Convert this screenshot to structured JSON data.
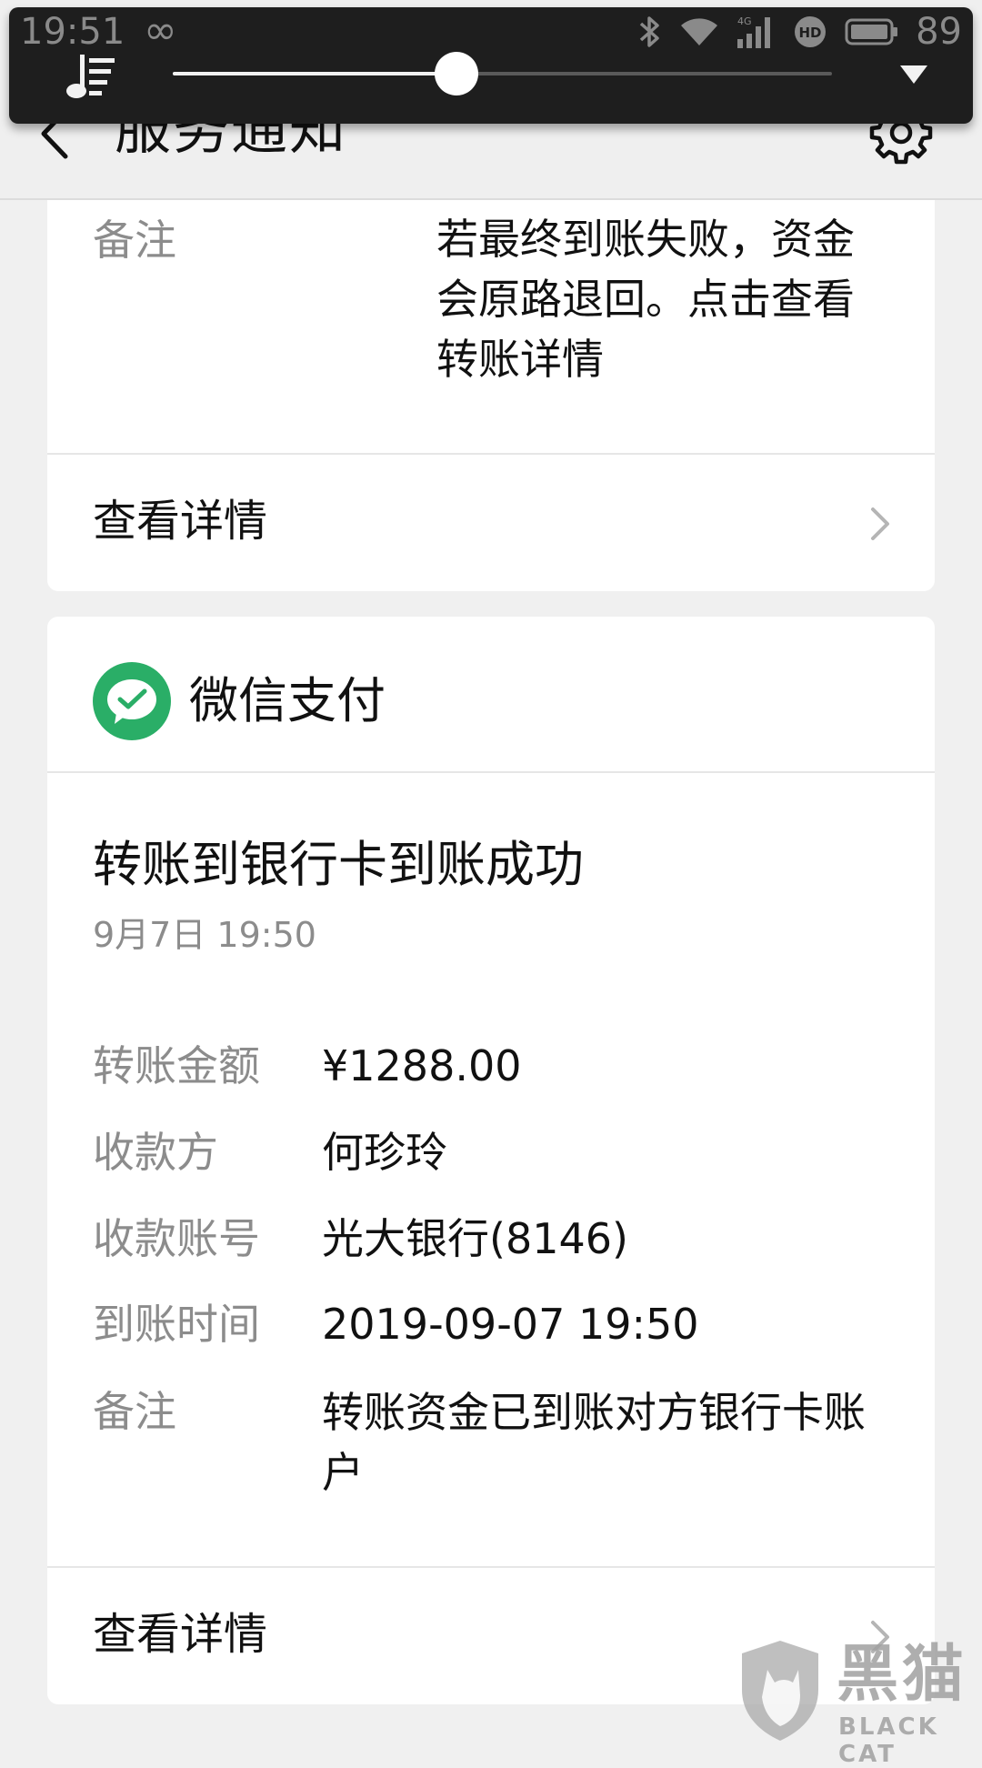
{
  "status_bar": {
    "time": "19:51",
    "loop_symbol": "∞",
    "network_label": "4G",
    "hd_label": "HD",
    "battery": "89"
  },
  "media": {
    "progress": 0.43
  },
  "header": {
    "title": "服务通知"
  },
  "card1": {
    "remark_label": "备注",
    "remark_value": "若最终到账失败，资金会原路退回。点击查看转账详情",
    "detail_label": "查看详情"
  },
  "card2": {
    "pay_name": "微信支付",
    "notice_title": "转账到银行卡到账成功",
    "notice_time": "9月7日  19:50",
    "fields": [
      {
        "label": "转账金额",
        "value": "¥1288.00"
      },
      {
        "label": "收款方",
        "value": "何珍玲"
      },
      {
        "label": "收款账号",
        "value": "光大银行(8146)"
      },
      {
        "label": "到账时间",
        "value": "2019-09-07 19:50"
      },
      {
        "label": "备注",
        "value": "转账资金已到账对方银行卡账户"
      }
    ],
    "detail_label": "查看详情"
  },
  "watermark": {
    "cn": "黑猫",
    "en": "BLACK CAT"
  },
  "colors": {
    "wechat_green": "#2aae67",
    "text_primary": "#111111",
    "text_secondary": "#8c8c8c",
    "background": "#f0f0f0"
  }
}
